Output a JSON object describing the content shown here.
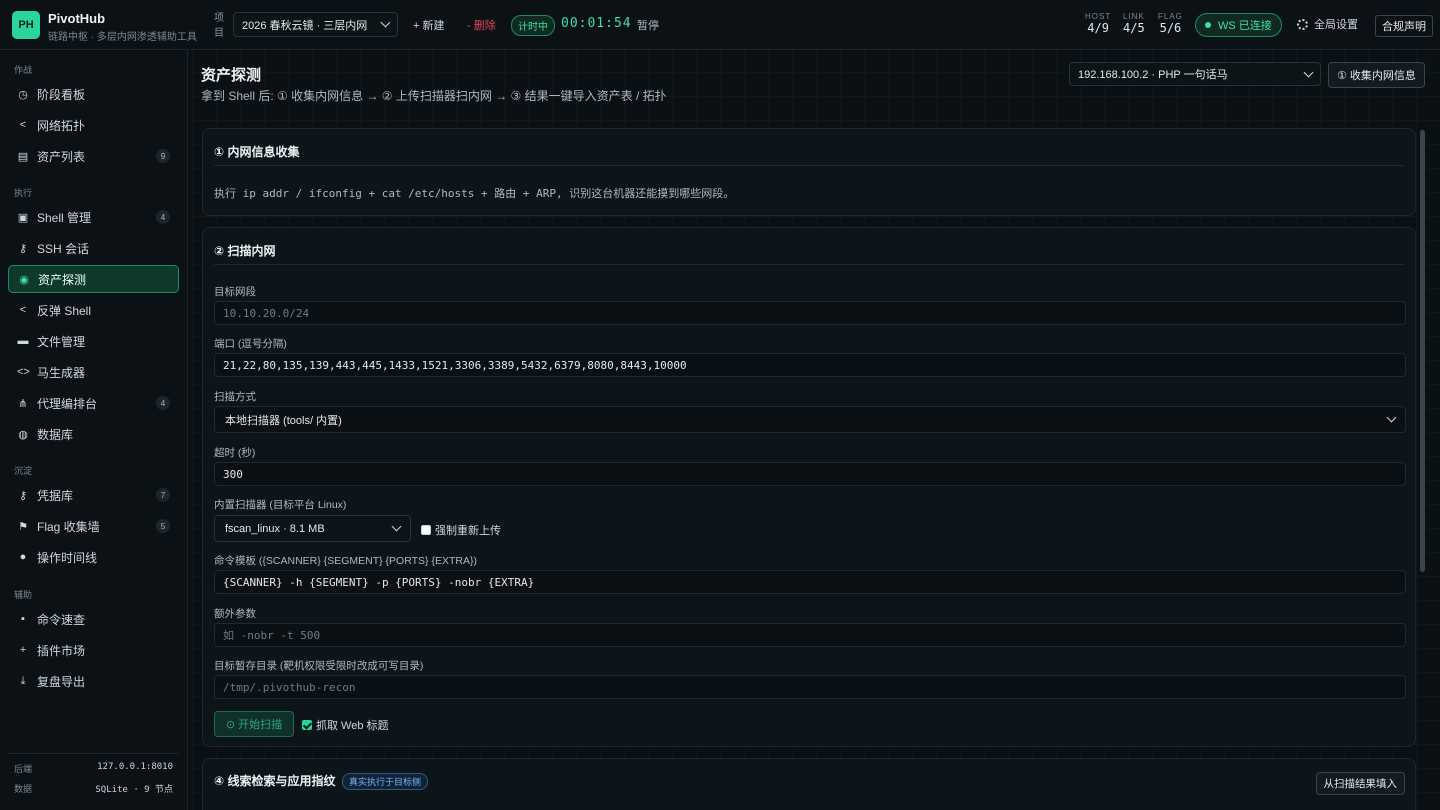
{
  "app": {
    "logo": "PH",
    "name": "PivotHub",
    "subtitle": "链路中枢 · 多层内网渗透辅助工具"
  },
  "topbar": {
    "project_label": "项目",
    "project_value": "2026 春秋云镜 · 三层内网",
    "new_label": "+ 新建",
    "delete_label": "- 删除",
    "timer_badge": "计时中",
    "timer": "00:01:54",
    "pause_label": "暂停",
    "stats": [
      {
        "label": "HOST",
        "value": "4/9"
      },
      {
        "label": "LINK",
        "value": "4/5"
      },
      {
        "label": "FLAG",
        "value": "5/6"
      }
    ],
    "ws_status": "WS 已连接",
    "settings_label": "全局设置",
    "compliance_label": "合规声明"
  },
  "sidebar": {
    "groups": [
      "作战",
      "执行",
      "沉淀",
      "辅助"
    ],
    "items": [
      {
        "icon": "clock-icon",
        "glyph": "◷",
        "label": "阶段看板",
        "badge": ""
      },
      {
        "icon": "share-icon",
        "glyph": "<",
        "label": "网络拓扑",
        "badge": ""
      },
      {
        "icon": "server-icon",
        "glyph": "▤",
        "label": "资产列表",
        "badge": "9"
      },
      {
        "icon": "terminal-icon",
        "glyph": "▣",
        "label": "Shell 管理",
        "badge": "4"
      },
      {
        "icon": "key-icon",
        "glyph": "⚷",
        "label": "SSH 会话",
        "badge": ""
      },
      {
        "icon": "globe-icon",
        "glyph": "◉",
        "label": "资产探测",
        "badge": ""
      },
      {
        "icon": "share-icon",
        "glyph": "<",
        "label": "反弹 Shell",
        "badge": ""
      },
      {
        "icon": "folder-icon",
        "glyph": "▬",
        "label": "文件管理",
        "badge": ""
      },
      {
        "icon": "code-icon",
        "glyph": "<>",
        "label": "马生成器",
        "badge": ""
      },
      {
        "icon": "sitemap-icon",
        "glyph": "⋔",
        "label": "代理编排台",
        "badge": "4"
      },
      {
        "icon": "database-icon",
        "glyph": "◍",
        "label": "数据库",
        "badge": ""
      },
      {
        "icon": "key-icon",
        "glyph": "⚷",
        "label": "凭据库",
        "badge": "7"
      },
      {
        "icon": "flag-icon",
        "glyph": "⚑",
        "label": "Flag 收集墙",
        "badge": "5"
      },
      {
        "icon": "timeline-icon",
        "glyph": "●",
        "label": "操作时间线",
        "badge": ""
      },
      {
        "icon": "book-icon",
        "glyph": "▪",
        "label": "命令速查",
        "badge": ""
      },
      {
        "icon": "plus-icon",
        "glyph": "+",
        "label": "插件市场",
        "badge": ""
      },
      {
        "icon": "download-icon",
        "glyph": "⤓",
        "label": "复盘导出",
        "badge": ""
      }
    ],
    "footer": [
      {
        "label": "后端",
        "value": "127.0.0.1:8010"
      },
      {
        "label": "数据",
        "value": "SQLite · 9 节点"
      }
    ]
  },
  "main": {
    "title": "资产探测",
    "subtitle": "拿到 Shell 后: ① 收集内网信息 → ② 上传扫描器扫内网 → ③ 结果一键导入资产表 / 拓扑",
    "target_select": "192.168.100.2 · PHP 一句话马",
    "collect_button": "① 收集内网信息",
    "card1": {
      "title": "① 内网信息收集",
      "text": "执行 ip addr / ifconfig + cat /etc/hosts + 路由 + ARP, 识别这台机器还能摸到哪些网段。"
    },
    "card2": {
      "title": "② 扫描内网",
      "segment_label": "目标网段",
      "segment_placeholder": "10.10.20.0/24",
      "ports_label": "端口 (逗号分隔)",
      "ports_value": "21,22,80,135,139,443,445,1433,1521,3306,3389,5432,6379,8080,8443,10000",
      "method_label": "扫描方式",
      "method_value": "本地扫描器 (tools/ 内置)",
      "timeout_label": "超时 (秒)",
      "timeout_value": "300",
      "scanner_label": "内置扫描器 (目标平台 Linux)",
      "scanner_value": "fscan_linux · 8.1 MB",
      "force_upload_label": "强制重新上传",
      "template_label": "命令模板 ({SCANNER} {SEGMENT} {PORTS} {EXTRA})",
      "template_value": "{SCANNER} -h {SEGMENT} -p {PORTS} -nobr {EXTRA}",
      "extra_label": "额外参数",
      "extra_placeholder": "如 -nobr -t 500",
      "tmpdir_label": "目标暂存目录 (靶机权限受限时改成可写目录)",
      "tmpdir_placeholder": "/tmp/.pivothub-recon",
      "start_button": "⊙ 开始扫描",
      "grab_title_label": "抓取 Web 标题"
    },
    "card4": {
      "title": "④ 线索检索与应用指纹",
      "tag": "真实执行于目标侧",
      "fill_button": "从扫描结果填入"
    }
  },
  "colors": {
    "accent": "#2bd49a",
    "danger": "#e0475b",
    "background": "#0b1014",
    "panel": "#0e151a"
  }
}
